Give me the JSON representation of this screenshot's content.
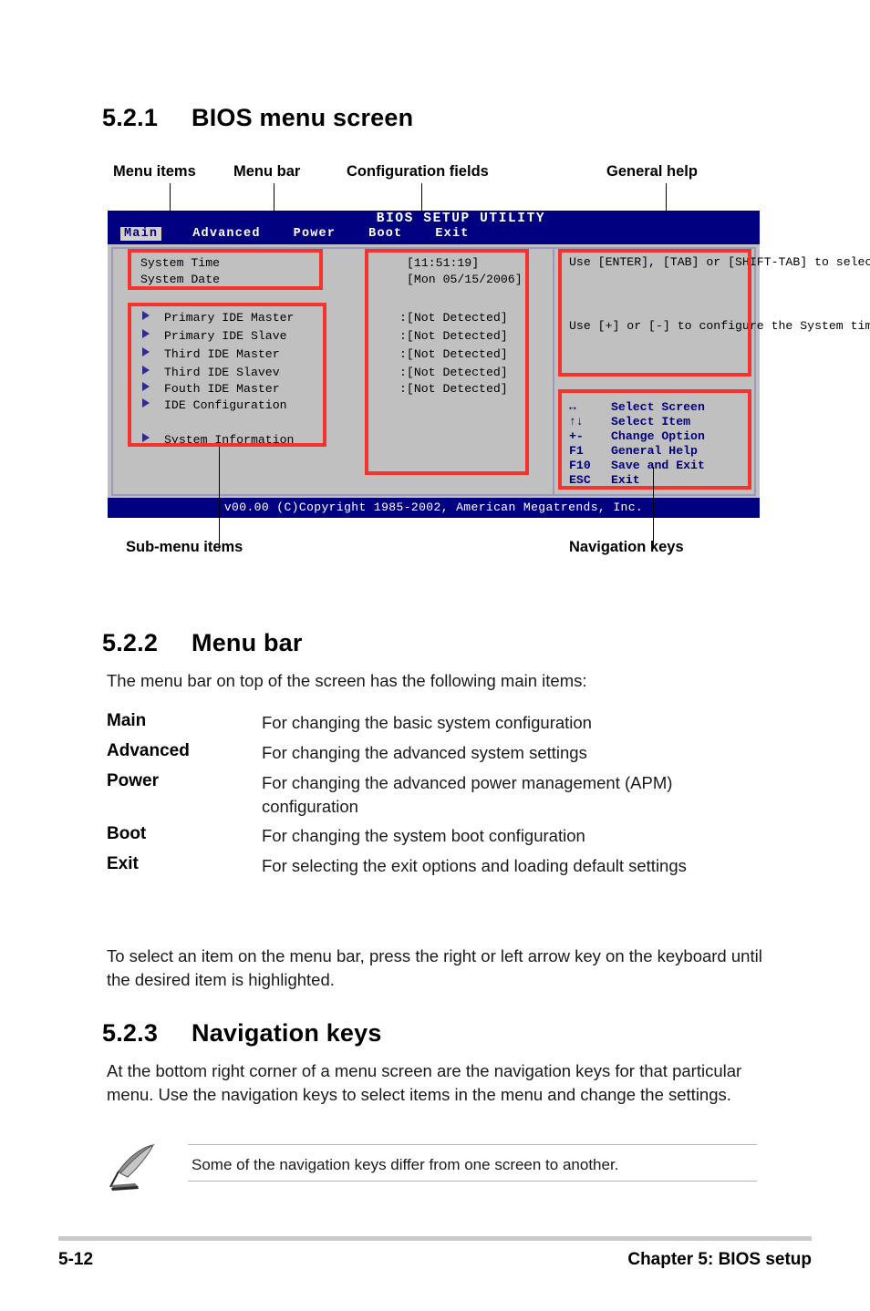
{
  "sections": {
    "s1": {
      "num": "5.2.1",
      "title": "BIOS menu screen"
    },
    "s2": {
      "num": "5.2.2",
      "title": "Menu bar"
    },
    "s3": {
      "num": "5.2.3",
      "title": "Navigation keys"
    }
  },
  "figure": {
    "callouts": {
      "menu_items": "Menu items",
      "menu_bar": "Menu bar",
      "config_fields": "Configuration fields",
      "general_help": "General help",
      "submenu_items": "Sub-menu items",
      "navigation_keys": "Navigation keys"
    },
    "bios": {
      "title": "BIOS SETUP UTILITY",
      "tabs": [
        {
          "label": "Main",
          "selected": true
        },
        {
          "label": "Advanced",
          "selected": false
        },
        {
          "label": "Power",
          "selected": false
        },
        {
          "label": "Boot",
          "selected": false
        },
        {
          "label": "Exit",
          "selected": false
        }
      ],
      "fields": [
        {
          "label": "System Time",
          "value": "[11:51:19]"
        },
        {
          "label": "System Date",
          "value": "[Mon 05/15/2006]"
        }
      ],
      "submenus": [
        {
          "label": "Primary IDE Master",
          "value": ":[Not Detected]"
        },
        {
          "label": "Primary IDE Slave",
          "value": ":[Not Detected]"
        },
        {
          "label": "Third IDE Master",
          "value": ":[Not Detected]"
        },
        {
          "label": "Third IDE Slavev",
          "value": ":[Not Detected]"
        },
        {
          "label": "Fouth IDE Master",
          "value": ":[Not Detected]"
        },
        {
          "label": "IDE Configuration",
          "value": ""
        }
      ],
      "system_information": "System Information",
      "help_paragraph_1": "Use [ENTER], [TAB] or\n[SHIFT-TAB] to select\na field.",
      "help_paragraph_2": "Use [+] or [-] to\nconfigure the System\ntime.",
      "nav_keys": [
        {
          "key": "↔",
          "action": "Select Screen"
        },
        {
          "key": "↑↓",
          "action": "Select Item"
        },
        {
          "key": "+-",
          "action": "Change Option"
        },
        {
          "key": "F1",
          "action": "General Help"
        },
        {
          "key": "F10",
          "action": "Save and Exit"
        },
        {
          "key": "ESC",
          "action": "Exit"
        }
      ],
      "copyright": "v00.00 (C)Copyright 1985-2002, American Megatrends, Inc."
    }
  },
  "menu_bar_section": {
    "intro": "The menu bar on top of the screen has the following main items:",
    "items": [
      {
        "term": "Main",
        "definition": "For changing the basic system configuration"
      },
      {
        "term": "Advanced",
        "definition": "For changing the advanced system settings"
      },
      {
        "term": "Power",
        "definition": "For changing the advanced power management (APM) configuration"
      },
      {
        "term": "Boot",
        "definition": "For changing the system boot configuration"
      },
      {
        "term": "Exit",
        "definition": "For selecting the exit options and loading default settings"
      }
    ],
    "outro": "To select an item on the menu bar, press the right or left arrow key on the keyboard until the desired item is highlighted."
  },
  "navigation_keys_section": {
    "body": "At the bottom right corner of a menu screen are the navigation keys for that particular menu. Use the navigation keys to select items in the menu and change the settings.",
    "note": "Some of the navigation keys differ from one screen to another."
  },
  "footer": {
    "page_number": "5-12",
    "chapter": "Chapter 5: BIOS setup"
  },
  "colors": {
    "bios_blue": "#000080",
    "bios_gray": "#c0c0c0",
    "annotation_red": "#f4332d",
    "submenu_arrow": "#2c2c8c"
  }
}
